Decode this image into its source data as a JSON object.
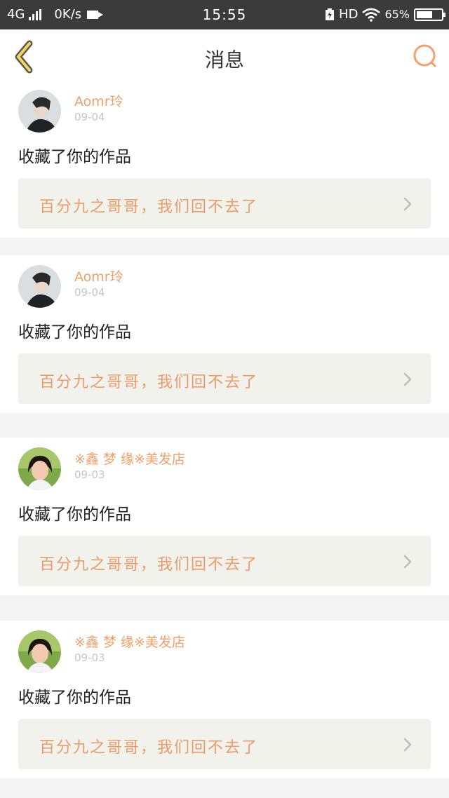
{
  "status_bar": {
    "network": "4G",
    "speed": "0K/s",
    "time": "15:55",
    "hd": "HD",
    "battery": "65%",
    "battery_level": 0.65,
    "icons": [
      "signal-icon",
      "video-icon",
      "charging-icon",
      "wifi-icon",
      "battery-icon"
    ]
  },
  "nav": {
    "title": "消息",
    "back_icon": "chevron-left-icon",
    "search_icon": "search-icon",
    "accent": "#f1a06b"
  },
  "messages": [
    {
      "username": "Aomr玲",
      "date": "09-04",
      "action": "收藏了你的作品",
      "work_title": "百分九之哥哥，我们回不去了",
      "avatar": "avatar-dark"
    },
    {
      "username": "Aomr玲",
      "date": "09-04",
      "action": "收藏了你的作品",
      "work_title": "百分九之哥哥，我们回不去了",
      "avatar": "avatar-dark"
    },
    {
      "username": "※鑫 梦 缘※美发店",
      "date": "09-03",
      "action": "收藏了你的作品",
      "work_title": "百分九之哥哥，我们回不去了",
      "avatar": "avatar-green"
    },
    {
      "username": "※鑫 梦 缘※美发店",
      "date": "09-03",
      "action": "收藏了你的作品",
      "work_title": "百分九之哥哥，我们回不去了",
      "avatar": "avatar-green"
    }
  ]
}
